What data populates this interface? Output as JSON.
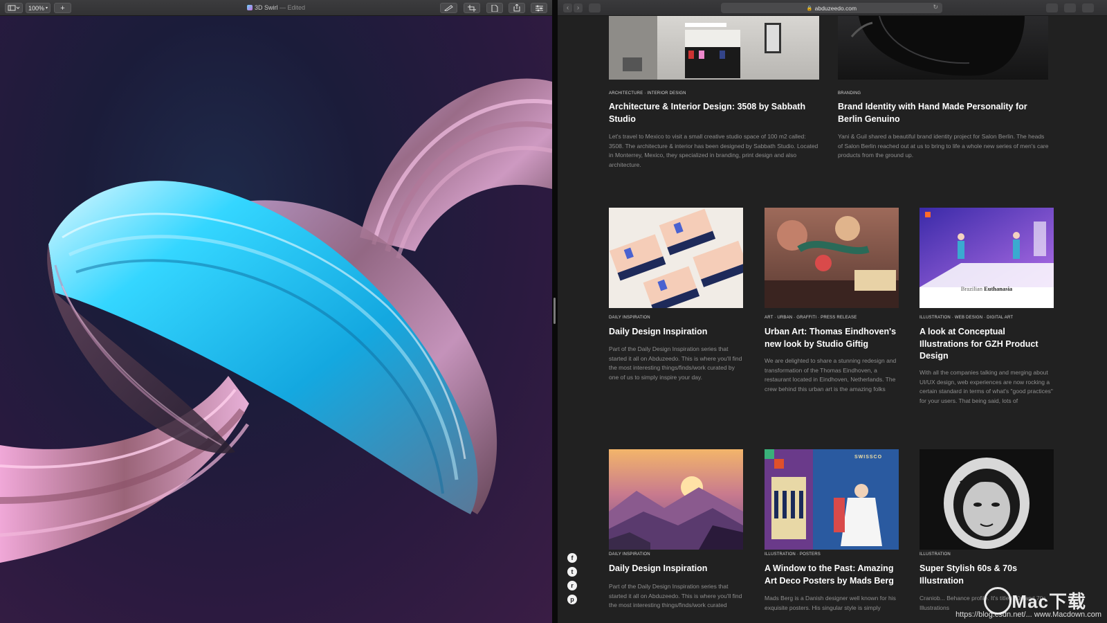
{
  "preview": {
    "zoom": "100%",
    "doc_name": "3D Swirl",
    "doc_status": "— Edited",
    "add_label": "+"
  },
  "safari": {
    "url": "abduzeedo.com"
  },
  "articles": [
    {
      "category": "ARCHITECTURE · INTERIOR DESIGN",
      "title": "Architecture & Interior Design: 3508 by Sabbath Studio",
      "excerpt": "Let's travel to Mexico to visit a small creative studio space of 100 m2 called: 3508. The architecture & interior has been designed by Sabbath Studio. Located in Monterrey, Mexico, they specialized in branding, print design and also architecture."
    },
    {
      "category": "BRANDING",
      "title": "Brand Identity with Hand Made Personality for Berlin Genuino",
      "excerpt": "Yani & Guil shared a beautiful brand identity project for Salon Berlin. The heads of Salon Berlin reached out at us to bring to life a whole new series of men's care products from the ground up."
    },
    {
      "category": "DAILY INSPIRATION",
      "title": "Daily Design Inspiration",
      "excerpt": "Part of the Daily Design Inspiration series that started it all on Abduzeedo. This is where you'll find the most interesting things/finds/work curated by one of us to simply inspire your day."
    },
    {
      "category": "ART · URBAN · GRAFFITI · PRESS RELEASE",
      "title": "Urban Art: Thomas Eindhoven's new look by Studio Giftig",
      "excerpt": "We are delighted to share a stunning redesign and transformation of the Thomas Eindhoven, a restaurant located in Eindhoven, Netherlands. The crew behind this urban art is the amazing folks"
    },
    {
      "category": "ILLUSTRATION · WEB DESIGN · DIGITAL ART",
      "title": "A look at Conceptual Illustrations for GZH Product Design",
      "excerpt": "With all the companies talking and merging about UI/UX design, web experiences are now rocking a certain standard in terms of what's \"good practices\" for your users. That being said, lots of",
      "image_caption_prefix": "Brazilian",
      "image_caption_bold": "Euthanasia"
    },
    {
      "category": "DAILY INSPIRATION",
      "title": "Daily Design Inspiration",
      "excerpt": "Part of the Daily Design Inspiration series that started it all on Abduzeedo. This is where you'll find the most interesting things/finds/work curated"
    },
    {
      "category": "ILLUSTRATION · POSTERS",
      "title": "A Window to the Past: Amazing Art Deco Posters by Mads Berg",
      "excerpt": "Mads Berg is a Danish designer well known for his exquisite posters. His singular style is simply",
      "image_caption": "SWISSCO"
    },
    {
      "category": "ILLUSTRATION",
      "title": "Super Stylish 60s & 70s Illustration",
      "excerpt": "Craniob... Behance profile. It's titled 60s and 70s Illustrations"
    }
  ],
  "social": {
    "facebook": "f",
    "twitter": "t",
    "reddit": "r",
    "pinterest": "p"
  },
  "watermark": {
    "logo": "Mac下载",
    "url": "https://blog.csdn.net/... www.Macdown.com"
  }
}
